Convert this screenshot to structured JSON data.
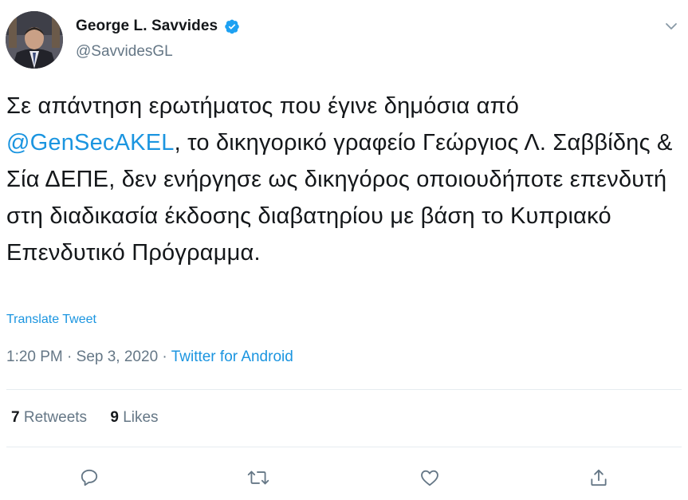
{
  "author": {
    "name": "George L. Savvides",
    "handle": "@SavvidesGL",
    "verified": true
  },
  "tweet": {
    "text_before": "Σε απάντηση ερωτήματος που έγινε δημόσια από ",
    "mention": "@GenSecAKEL",
    "text_after": ", το δικηγορικό γραφείο Γεώργιος Λ. Σαββίδης & Σία ΔΕΠΕ, δεν ενήργησε ως δικηγόρος οποιουδήποτε επενδυτή στη διαδικασία έκδοσης διαβατηρίου με βάση το Κυπριακό Επενδυτικό Πρόγραμμα."
  },
  "translate_label": "Translate Tweet",
  "meta": {
    "time": "1:20 PM",
    "separator1": " · ",
    "date": "Sep 3, 2020",
    "separator2": " · ",
    "source": "Twitter for Android"
  },
  "stats": {
    "retweets_count": "7",
    "retweets_label": "Retweets",
    "likes_count": "9",
    "likes_label": "Likes"
  },
  "icons": {
    "verified": "verified-badge-icon",
    "caret": "chevron-down-icon",
    "reply": "reply-icon",
    "retweet": "retweet-icon",
    "like": "heart-icon",
    "share": "share-icon"
  },
  "colors": {
    "link": "#1b95e0",
    "secondary_text": "#657786",
    "primary_text": "#14171a",
    "divider": "#e6ecf0",
    "verified": "#1da1f2"
  }
}
